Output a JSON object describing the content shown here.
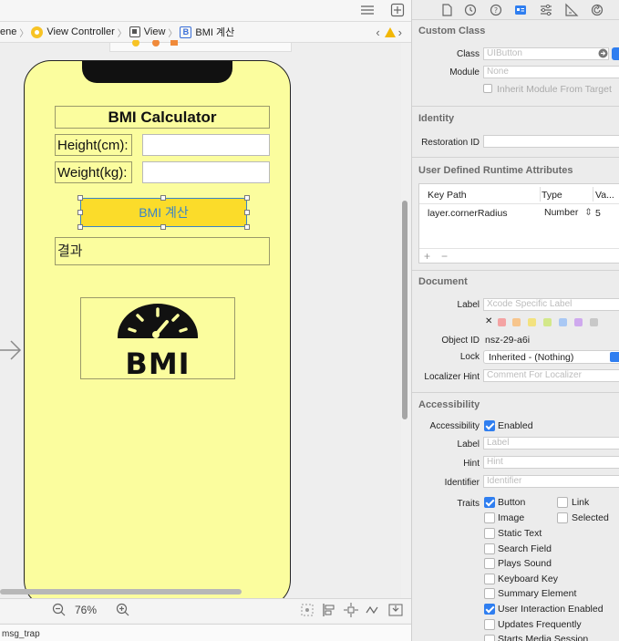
{
  "jump_bar": {
    "crumbs": [
      "ene",
      "View Controller",
      "View",
      "BMI 계산"
    ]
  },
  "canvas": {
    "title": "BMI Calculator",
    "height_label": "Height(cm):",
    "weight_label": "Weight(kg):",
    "button_label": "BMI 계산",
    "result_label": "결과",
    "logo_text": "BMI",
    "zoom_level": "76%"
  },
  "debug": {
    "text": "msg_trap"
  },
  "inspector": {
    "custom_class": {
      "title": "Custom Class",
      "class_label": "Class",
      "class_placeholder": "UIButton",
      "module_label": "Module",
      "module_placeholder": "None",
      "inherit_label": "Inherit Module From Target"
    },
    "identity": {
      "title": "Identity",
      "restoration_label": "Restoration ID"
    },
    "runtime": {
      "title": "User Defined Runtime Attributes",
      "col_keypath": "Key Path",
      "col_type": "Type",
      "col_value": "Va...",
      "row_keypath": "layer.cornerRadius",
      "row_type": "Number",
      "row_value": "5",
      "add_label": "+",
      "remove_label": "−"
    },
    "document": {
      "title": "Document",
      "label_label": "Label",
      "label_placeholder": "Xcode Specific Label",
      "clear_glyph": "✕",
      "label_colors": [
        "#f4a3a3",
        "#f7c58c",
        "#f3e27f",
        "#d3e88a",
        "#a9c8f4",
        "#cfa9ee",
        "#c8c8c8"
      ],
      "object_id_label": "Object ID",
      "object_id_value": "nsz-29-a6i",
      "lock_label": "Lock",
      "lock_value": "Inherited - (Nothing)",
      "localizer_label": "Localizer Hint",
      "localizer_placeholder": "Comment For Localizer"
    },
    "accessibility": {
      "title": "Accessibility",
      "accessibility_label": "Accessibility",
      "enabled_label": "Enabled",
      "label_label": "Label",
      "label_placeholder": "Label",
      "hint_label": "Hint",
      "hint_placeholder": "Hint",
      "identifier_label": "Identifier",
      "identifier_placeholder": "Identifier",
      "traits_label": "Traits",
      "traits": {
        "button": "Button",
        "link": "Link",
        "image": "Image",
        "selected": "Selected",
        "static_text": "Static Text",
        "search_field": "Search Field",
        "plays_sound": "Plays Sound",
        "keyboard_key": "Keyboard Key",
        "summary_element": "Summary Element",
        "user_interaction": "User Interaction Enabled",
        "updates_frequently": "Updates Frequently",
        "starts_media": "Starts Media Session"
      }
    }
  }
}
